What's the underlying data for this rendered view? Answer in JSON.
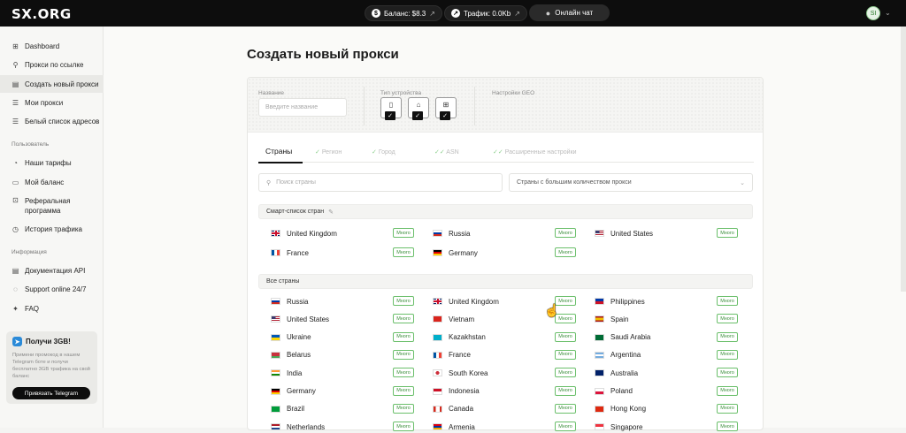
{
  "topbar": {
    "logo": "SX.ORG",
    "balance": "Баланс: $8.3",
    "traffic": "Трафик: 0.0Kb",
    "chat": "Онлайн чат",
    "avatar": "SI"
  },
  "sidebar": {
    "main_items": [
      {
        "label": "Dashboard",
        "icon": "grid-icon"
      },
      {
        "label": "Прокси по ссылке",
        "icon": "link-icon"
      },
      {
        "label": "Создать новый прокси",
        "icon": "doc-icon"
      },
      {
        "label": "Мои прокси",
        "icon": "list-icon"
      },
      {
        "label": "Белый список адресов",
        "icon": "list-icon"
      }
    ],
    "section_user": "Пользователь",
    "user_items": [
      {
        "label": "Наши тарифы",
        "icon": "tariff-icon"
      },
      {
        "label": "Мой баланс",
        "icon": "wallet-icon"
      },
      {
        "label": "Реферальная",
        "label2": "программа",
        "icon": "gift-icon"
      },
      {
        "label": "История трафика",
        "icon": "history-icon"
      }
    ],
    "section_info": "Информация",
    "info_items": [
      {
        "label": "Документация API",
        "icon": "doc-icon"
      },
      {
        "label": "Support online 24/7",
        "icon": "chat-icon"
      },
      {
        "label": "FAQ",
        "icon": "sparkle-icon"
      }
    ],
    "promo": {
      "title": "Получи 3GB!",
      "text": "Примени промокод в нашем Telegram боте и получи бесплатно 3GB трафика на свой баланс",
      "button": "Привязать Telegram"
    }
  },
  "page": {
    "title": "Создать новый прокси",
    "name_label": "Название",
    "name_placeholder": "Введите название",
    "device_label": "Тип устройства",
    "geo_label": "Настройки GEO",
    "tabs": [
      "Страны",
      "Регион",
      "Город",
      "ASN",
      "Расширенные настройки"
    ],
    "search_placeholder": "Поиск страны",
    "filter_select": "Страны с большим количеством прокси",
    "smart_list_title": "Смарт-список стран",
    "all_countries_title": "Все страны",
    "badge": "Много"
  },
  "smart_list": [
    {
      "name": "United Kingdom",
      "flag": "uk"
    },
    {
      "name": "Russia",
      "flag": "ru"
    },
    {
      "name": "United States",
      "flag": "us"
    },
    {
      "name": "France",
      "flag": "fr"
    },
    {
      "name": "Germany",
      "flag": "de"
    }
  ],
  "all_countries": [
    {
      "name": "Russia",
      "flag": "ru"
    },
    {
      "name": "United Kingdom",
      "flag": "uk"
    },
    {
      "name": "Philippines",
      "flag": "ph"
    },
    {
      "name": "United States",
      "flag": "us"
    },
    {
      "name": "Vietnam",
      "flag": "vn"
    },
    {
      "name": "Spain",
      "flag": "es"
    },
    {
      "name": "Ukraine",
      "flag": "ua"
    },
    {
      "name": "Kazakhstan",
      "flag": "kz"
    },
    {
      "name": "Saudi Arabia",
      "flag": "sa"
    },
    {
      "name": "Belarus",
      "flag": "by"
    },
    {
      "name": "France",
      "flag": "fr"
    },
    {
      "name": "Argentina",
      "flag": "ar"
    },
    {
      "name": "India",
      "flag": "in"
    },
    {
      "name": "South Korea",
      "flag": "kr"
    },
    {
      "name": "Australia",
      "flag": "au"
    },
    {
      "name": "Germany",
      "flag": "de"
    },
    {
      "name": "Indonesia",
      "flag": "id"
    },
    {
      "name": "Poland",
      "flag": "pl"
    },
    {
      "name": "Brazil",
      "flag": "br"
    },
    {
      "name": "Canada",
      "flag": "ca"
    },
    {
      "name": "Hong Kong",
      "flag": "hk"
    },
    {
      "name": "Netherlands",
      "flag": "nl"
    },
    {
      "name": "Armenia",
      "flag": "am"
    },
    {
      "name": "Singapore",
      "flag": "sg"
    }
  ]
}
